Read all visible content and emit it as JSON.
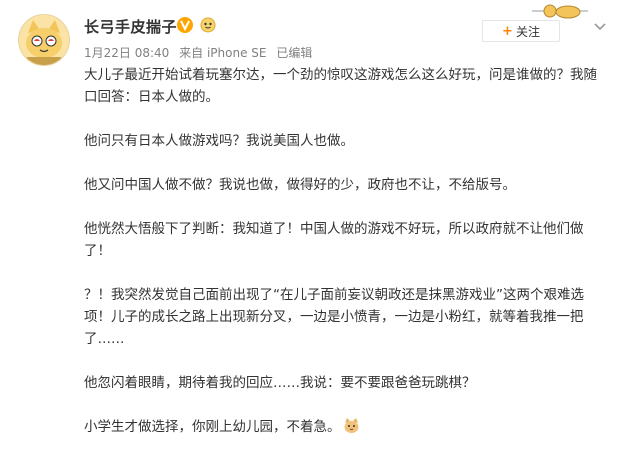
{
  "header": {
    "username": "长弓手皮揣子",
    "timestamp": "1月22日 08:40",
    "source": "来自 iPhone SE",
    "edited": "已编辑",
    "follow_label": "关注"
  },
  "post": {
    "paragraphs": [
      "大儿子最近开始试着玩塞尔达，一个劲的惊叹这游戏怎么这么好玩，问是谁做的？我随口回答：日本人做的。",
      "他问只有日本人做游戏吗？我说美国人也做。",
      "他又问中国人做不做？我说也做，做得好的少，政府也不让，不给版号。",
      "他恍然大悟般下了判断：我知道了！中国人做的游戏不好玩，所以政府就不让他们做了！",
      "？！我突然发觉自己面前出现了“在儿子面前妄议朝政还是抹黑游戏业”这两个艰难选项！儿子的成长之路上出现新分叉，一边是小愤青，一边是小粉红，就等着我推一把了……",
      "他忽闪着眼睛，期待着我的回应……我说：要不要跟爸爸玩跳棋？",
      "小学生才做选择，你刚上幼儿园，不着急。"
    ]
  },
  "icons": {
    "avatar": "cartoon-cat-avatar",
    "badge": "vip-v-badge",
    "medal": "user-medal-icon",
    "decoration": "cat-card-decoration",
    "menu": "chevron-down-icon",
    "emoji": "cat-emoji"
  },
  "colors": {
    "accent": "#ff8200",
    "text": "#333333",
    "meta": "#808080"
  }
}
